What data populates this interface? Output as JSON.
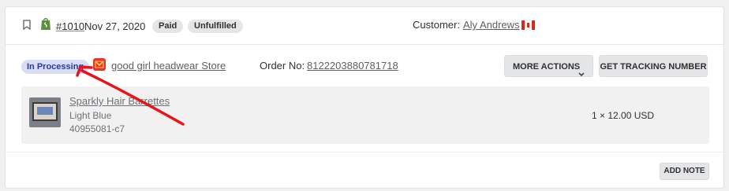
{
  "order": {
    "number": "#1010",
    "date": "Nov 27, 2020",
    "badges": [
      "Paid",
      "Unfulfilled"
    ],
    "customer_label": "Customer:",
    "customer_name": "Aly Andrews",
    "customer_flag": "canada-flag-icon"
  },
  "fulfillment": {
    "status": "In Processing",
    "store_name": "good girl headwear Store",
    "order_no_label": "Order No:",
    "order_no": "8122203880781718",
    "more_actions_label": "MORE ACTIONS",
    "tracking_label": "GET TRACKING NUMBER"
  },
  "line_item": {
    "title": "Sparkly Hair Barrettes",
    "variant": "Light Blue",
    "sku": "40955081-c7",
    "quantity_price": "1 × 12.00 USD"
  },
  "footer": {
    "add_note_label": "ADD NOTE"
  },
  "colors": {
    "status_pill_bg": "#d9dcf6",
    "status_pill_text": "#2a3a9a",
    "annotation_arrow": "#e8141c",
    "shopify_green": "#5e8e3e",
    "store_icon_red": "#e8352b"
  }
}
